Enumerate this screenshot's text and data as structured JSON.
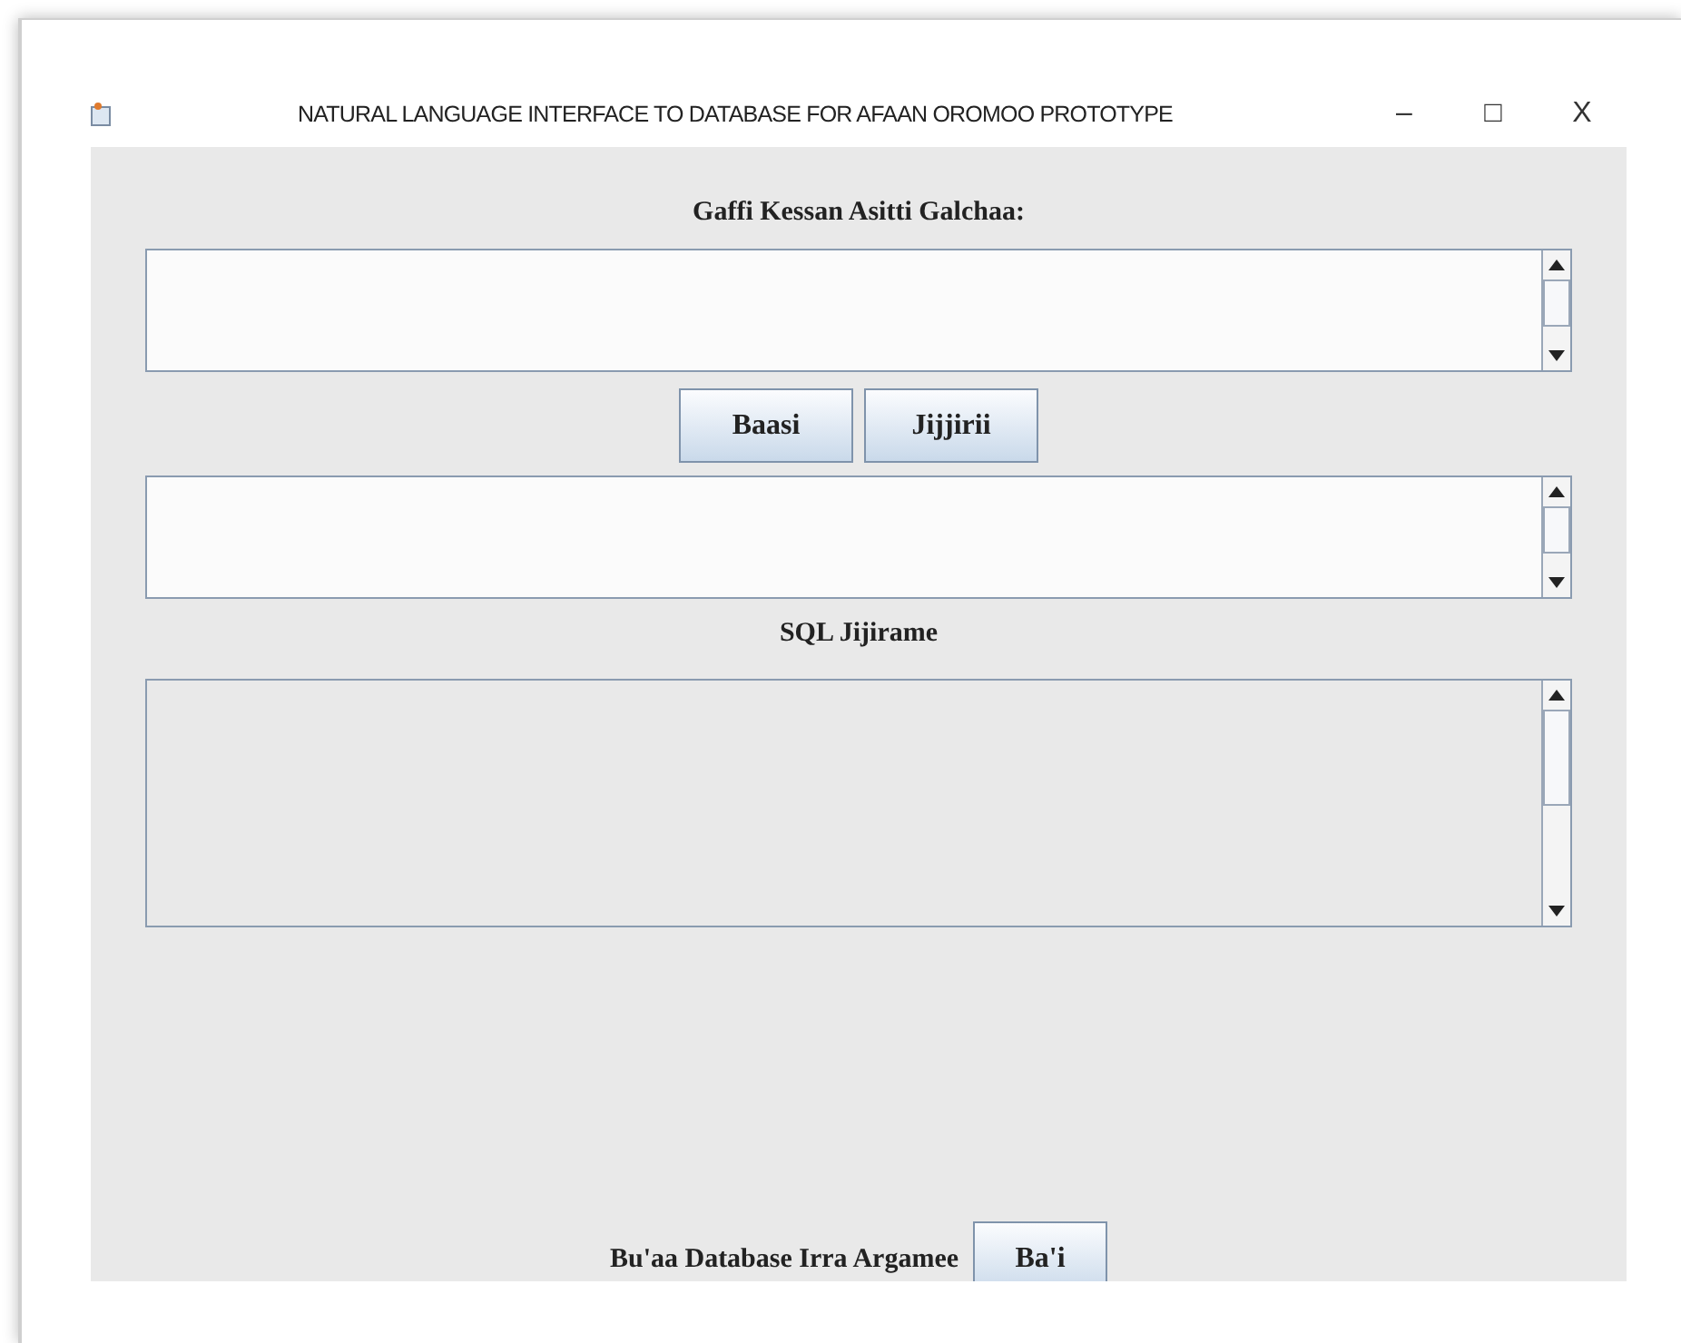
{
  "window": {
    "title": "NATURAL LANGUAGE INTERFACE TO DATABASE FOR AFAAN OROMOO PROTOTYPE",
    "controls": [
      "–",
      "□",
      "X"
    ]
  },
  "question_label": "Gaffi Kessan Asitti Galchaa:",
  "question_area": {
    "editable": true
  },
  "buttons": [
    "Baasi",
    "Jijjirii"
  ],
  "output_area": {
    "editable": true
  },
  "sql_label": "SQL Jijirame",
  "sql_area": {
    "editable": false
  },
  "footer": {
    "label": "Bu'aa Database Irra Argamee",
    "button": "Ba'i"
  }
}
